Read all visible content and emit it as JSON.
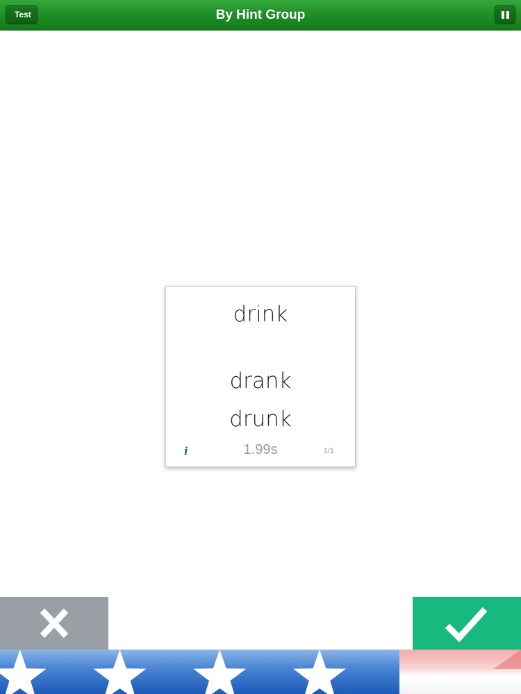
{
  "navbar": {
    "title": "By Hint Group",
    "back_label": "Test",
    "pause_icon": "pause-icon"
  },
  "card": {
    "prompt": "drink",
    "answers": [
      "drank",
      "drunk"
    ],
    "info_label": "i",
    "timer": "1.99s",
    "counter": "1/1"
  },
  "buttons": {
    "wrong_icon": "close-icon",
    "correct_icon": "checkmark-icon"
  },
  "progress": {
    "fraction": 0.767,
    "stars": 4
  },
  "colors": {
    "nav_green": "#1f8f25",
    "wrong_gray": "#9a9fa5",
    "correct_green": "#17b97e",
    "progress_blue": "#1c5bb8",
    "progress_red": "#f5aaa9"
  }
}
